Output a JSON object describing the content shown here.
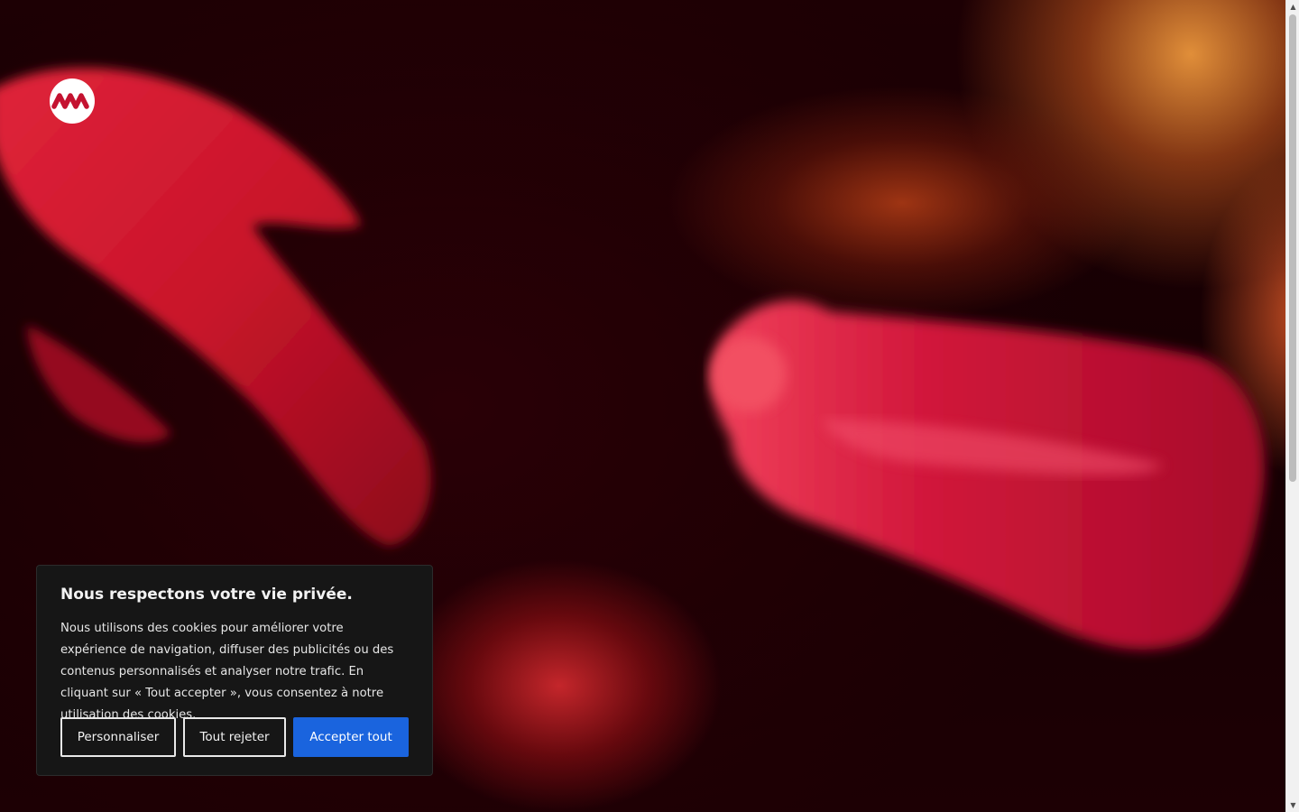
{
  "brand": {
    "logo_icon": "brand-logo-icon"
  },
  "cookie_banner": {
    "title": "Nous respectons votre vie privée.",
    "description": "Nous utilisons des cookies pour améliorer votre expérience de navigation, diffuser des publicités ou des contenus personnalisés et analyser notre trafic. En cliquant sur « Tout accepter », vous consentez à notre utilisation des cookies.",
    "customize_label": "Personnaliser",
    "reject_label": "Tout rejeter",
    "accept_label": "Accepter tout",
    "accent_color": "#1a64de"
  },
  "scrollbar": {
    "up_icon": "scroll-up-arrow-icon",
    "down_icon": "scroll-down-arrow-icon"
  }
}
